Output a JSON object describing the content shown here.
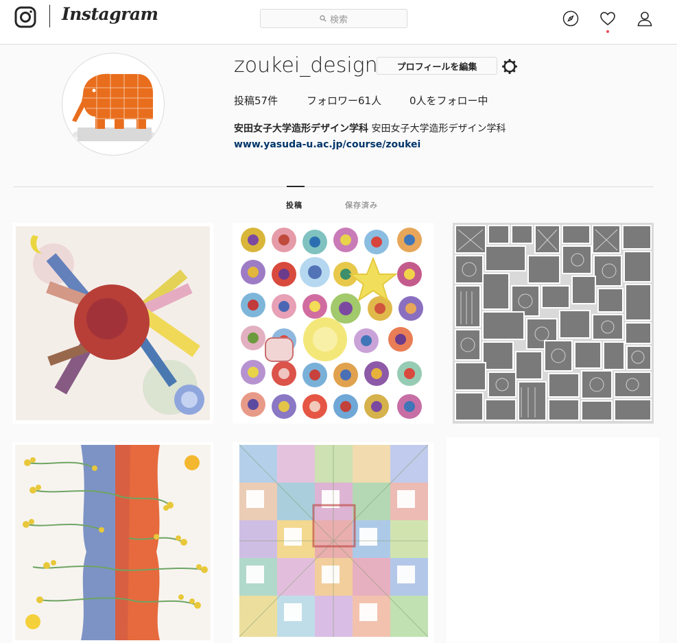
{
  "nav": {
    "wordmark": "Instagram",
    "search_placeholder": "検索",
    "icons": [
      "instagram-logo-icon",
      "compass-icon",
      "heart-icon",
      "user-icon"
    ],
    "notification_dot_color": "#ed4956"
  },
  "profile": {
    "username": "zoukei_design",
    "edit_button": "プロフィールを編集",
    "stats": {
      "posts": "投稿57件",
      "followers": "フォロワー61人",
      "following": "0人をフォロー中"
    },
    "full_name": "安田女子大学造形デザイン学科",
    "bio": "安田女子大学造形デザイン学科",
    "website": "www.yasuda-u.ac.jp/course/zoukei",
    "avatar_color": "#e86e1d"
  },
  "tabs": [
    {
      "label": "投稿",
      "active": true
    },
    {
      "label": "保存済み",
      "active": false
    }
  ],
  "posts": [
    {
      "art": "watercolor-radial-city-painting"
    },
    {
      "art": "watercolor-circles-star-painting"
    },
    {
      "art": "monochrome-stamp-pattern-grid"
    },
    {
      "art": "rapeseed-flowers-blue-orange-painting"
    },
    {
      "art": "watercolor-geometric-grid-pattern"
    }
  ]
}
